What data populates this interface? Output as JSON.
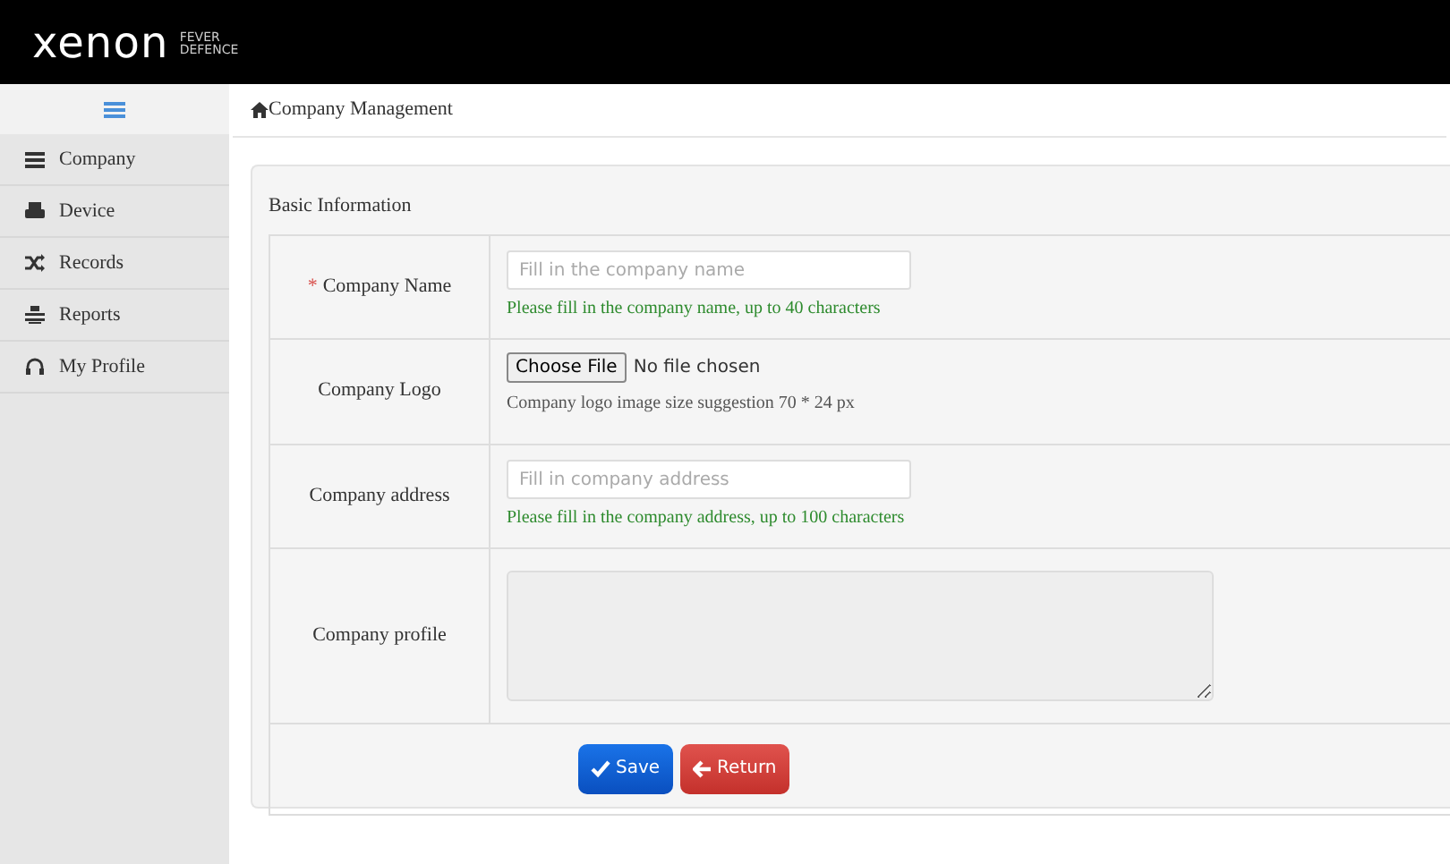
{
  "header": {
    "logo": "xenon",
    "logo_sub_top": "FEVER",
    "logo_sub_bottom": "DEFENCE"
  },
  "sidebar": {
    "items": [
      {
        "label": "Company"
      },
      {
        "label": "Device"
      },
      {
        "label": "Records"
      },
      {
        "label": "Reports"
      },
      {
        "label": "My Profile"
      }
    ]
  },
  "breadcrumb": "Company Management",
  "panel": {
    "title": "Basic Information",
    "rows": [
      {
        "kind": "text",
        "label": "Company Name",
        "required_mark": "*",
        "placeholder": "Fill in the company name",
        "hint": "Please fill in the company name, up to 40 characters"
      },
      {
        "kind": "file",
        "label": "Company Logo",
        "button": "Choose File",
        "status": "No file chosen",
        "hint": "Company logo image size suggestion 70 * 24 px"
      },
      {
        "kind": "text",
        "label": "Company address",
        "placeholder": "Fill in company address",
        "hint": "Please fill in the company address, up to 100 characters"
      },
      {
        "kind": "textarea",
        "label": "Company profile",
        "disabled": true
      }
    ],
    "buttons": [
      {
        "label": "Save",
        "kind": "primary"
      },
      {
        "label": "Return",
        "kind": "danger"
      }
    ]
  }
}
